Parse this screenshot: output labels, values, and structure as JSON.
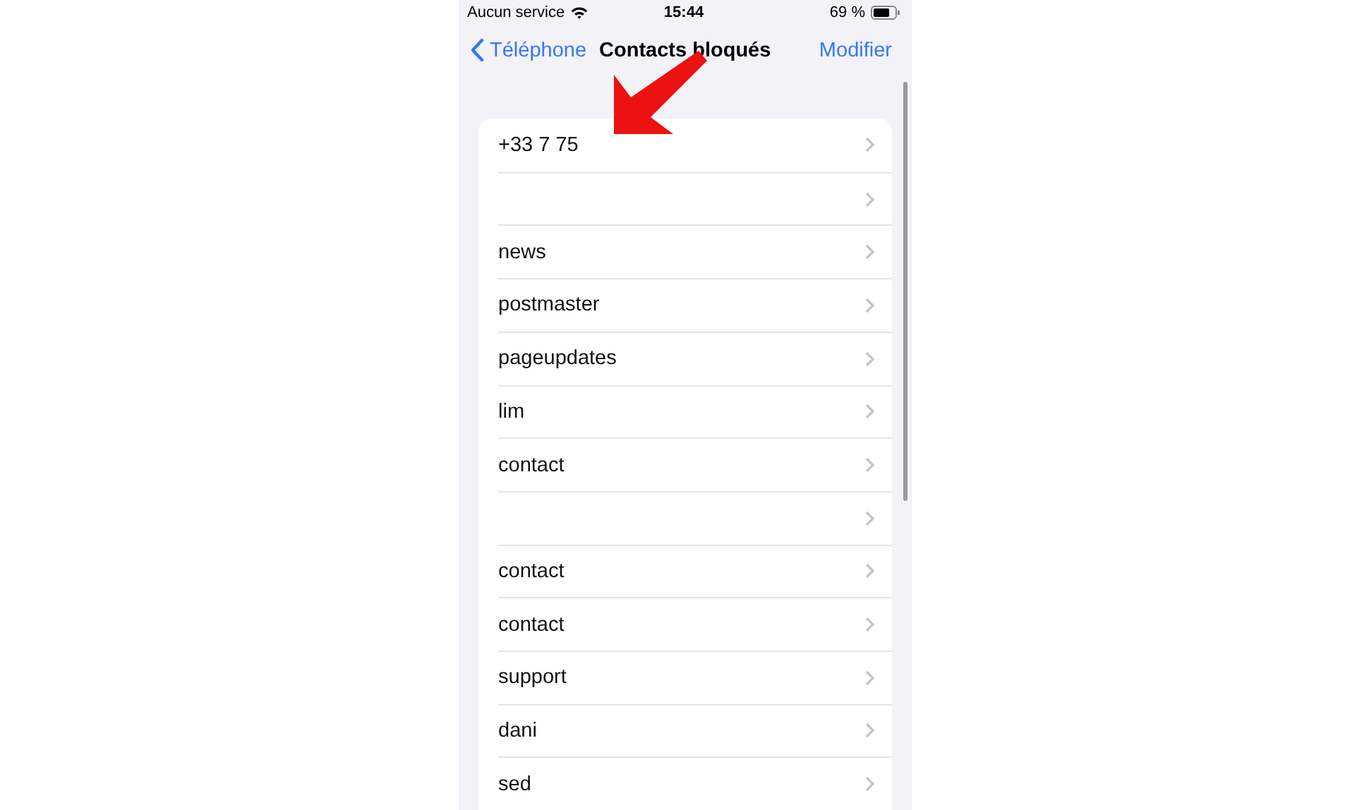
{
  "status_bar": {
    "carrier": "Aucun service",
    "time": "15:44",
    "battery": "69 %"
  },
  "nav": {
    "back": "Téléphone",
    "title": "Contacts bloqués",
    "action": "Modifier"
  },
  "contacts": [
    {
      "kind": "named",
      "label": "+33 7 75"
    },
    {
      "kind": "blank"
    },
    {
      "kind": "named",
      "label": "news"
    },
    {
      "kind": "named",
      "label": "postmaster"
    },
    {
      "kind": "named",
      "label": "pageupdates"
    },
    {
      "kind": "named",
      "label": "lim"
    },
    {
      "kind": "named",
      "label": "contact"
    },
    {
      "kind": "blank"
    },
    {
      "kind": "named",
      "label": "contact"
    },
    {
      "kind": "named",
      "label": "contact"
    },
    {
      "kind": "named",
      "label": "support"
    },
    {
      "kind": "named",
      "label": "dani"
    },
    {
      "kind": "named",
      "label": "sed"
    }
  ]
}
